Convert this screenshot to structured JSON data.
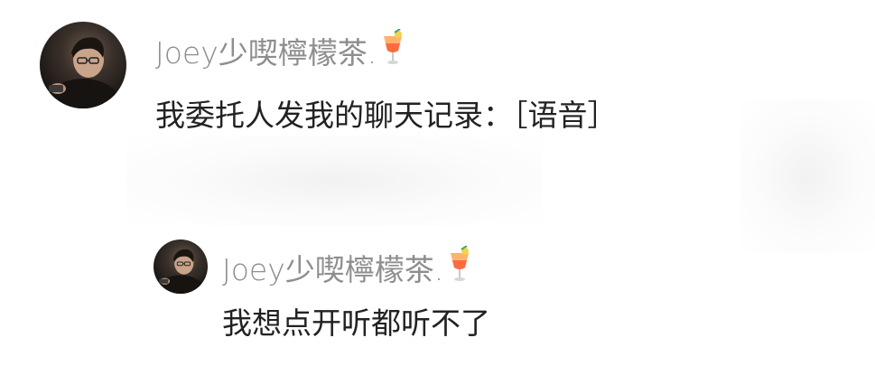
{
  "comments": [
    {
      "username": "Joey少喫檸檬茶.",
      "user_icon": "cocktail-icon",
      "text": "我委托人发我的聊天记录：［语音］"
    },
    {
      "username": "Joey少喫檸檬茶.",
      "user_icon": "cocktail-icon",
      "text": "我想点开听都听不了"
    }
  ]
}
